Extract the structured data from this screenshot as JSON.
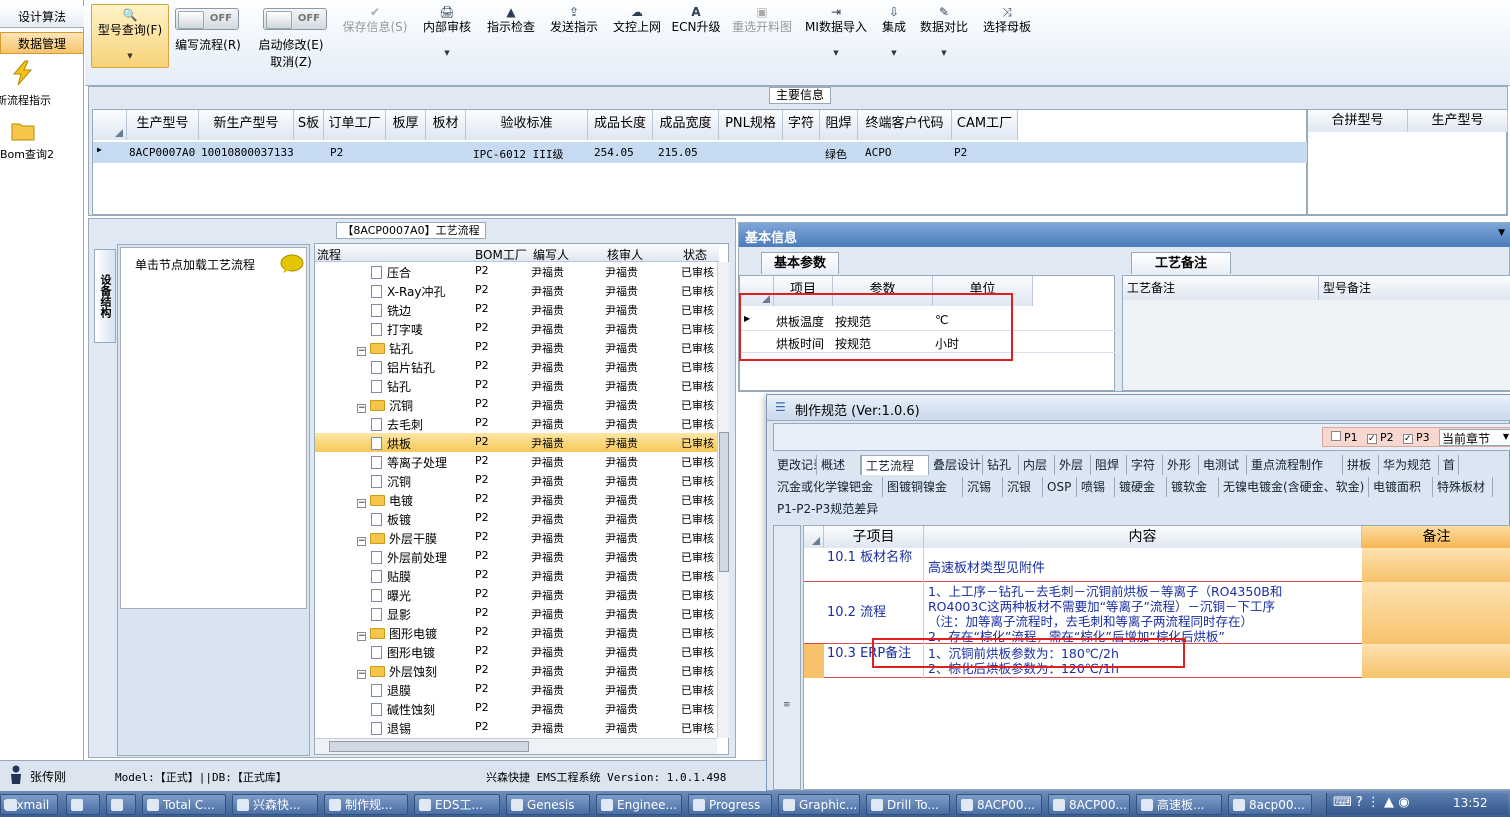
{
  "leftnav": {
    "tab1": "设计算法",
    "tab2": "数据管理",
    "item1": "新流程指示",
    "item2": "Bom查询2",
    "user": "张传刚"
  },
  "ribbon": {
    "buttons": [
      {
        "label": "型号查询(F)",
        "icon": "🔍"
      },
      {
        "label": "保存信息(S)",
        "icon": "✔"
      },
      {
        "label": "内部审核",
        "icon": "🖨"
      },
      {
        "label": "指示检查",
        "icon": "▲"
      },
      {
        "label": "发送指示",
        "icon": "⇪"
      },
      {
        "label": "文控上网",
        "icon": "☁"
      },
      {
        "label": "ECN升级",
        "icon": "A"
      },
      {
        "label": "重选开料图",
        "icon": "▣"
      },
      {
        "label": "MI数据导入",
        "icon": "⇥"
      },
      {
        "label": "集成",
        "icon": "⇩"
      },
      {
        "label": "数据对比",
        "icon": "✎"
      },
      {
        "label": "选择母板",
        "icon": "⤨"
      }
    ],
    "toggle1": {
      "state": "OFF",
      "label": "编写流程(R)"
    },
    "toggle2": {
      "state": "OFF",
      "label": "启动修改(E)",
      "sub": "取消(Z)"
    }
  },
  "main_info": {
    "title": "主要信息",
    "columns": [
      "生产型号",
      "新生产型号",
      "S板",
      "订单工厂",
      "板厚",
      "板材",
      "验收标准",
      "成品长度",
      "成品宽度",
      "PNL规格",
      "字符",
      "阻焊",
      "终端客户代码",
      "CAM工厂"
    ],
    "row": [
      "8ACP0007A0",
      "10010800037133",
      "",
      "P2",
      "",
      "",
      "IPC-6012 III级",
      "254.05",
      "215.05",
      "",
      "",
      "绿色",
      "ACPO",
      "P2"
    ],
    "side_columns": [
      "合拼型号",
      "生产型号"
    ]
  },
  "process": {
    "title": "【8ACP0007A0】工艺流程",
    "side_tab": "设备结构",
    "load_hint": "单击节点加载工艺流程",
    "columns": [
      "流程",
      "BOM工厂",
      "编写人",
      "核审人",
      "状态"
    ],
    "rows": [
      {
        "name": "压合",
        "type": "doc",
        "f": "P2",
        "w": "尹福贵",
        "r": "尹福贵",
        "s": "已审核"
      },
      {
        "name": "X-Ray冲孔",
        "type": "doc",
        "f": "P2",
        "w": "尹福贵",
        "r": "尹福贵",
        "s": "已审核"
      },
      {
        "name": "铣边",
        "type": "doc",
        "f": "P2",
        "w": "尹福贵",
        "r": "尹福贵",
        "s": "已审核"
      },
      {
        "name": "打字唛",
        "type": "doc",
        "f": "P2",
        "w": "尹福贵",
        "r": "尹福贵",
        "s": "已审核"
      },
      {
        "name": "钻孔",
        "type": "folder",
        "f": "P2",
        "w": "尹福贵",
        "r": "尹福贵",
        "s": "已审核"
      },
      {
        "name": "铝片钻孔",
        "type": "doc",
        "f": "P2",
        "w": "尹福贵",
        "r": "尹福贵",
        "s": "已审核"
      },
      {
        "name": "钻孔",
        "type": "doc",
        "f": "P2",
        "w": "尹福贵",
        "r": "尹福贵",
        "s": "已审核"
      },
      {
        "name": "沉铜",
        "type": "folder",
        "f": "P2",
        "w": "尹福贵",
        "r": "尹福贵",
        "s": "已审核"
      },
      {
        "name": "去毛刺",
        "type": "doc",
        "f": "P2",
        "w": "尹福贵",
        "r": "尹福贵",
        "s": "已审核"
      },
      {
        "name": "烘板",
        "type": "doc",
        "f": "P2",
        "w": "尹福贵",
        "r": "尹福贵",
        "s": "已审核",
        "sel": true
      },
      {
        "name": "等离子处理",
        "type": "doc",
        "f": "P2",
        "w": "尹福贵",
        "r": "尹福贵",
        "s": "已审核"
      },
      {
        "name": "沉铜",
        "type": "doc",
        "f": "P2",
        "w": "尹福贵",
        "r": "尹福贵",
        "s": "已审核"
      },
      {
        "name": "电镀",
        "type": "folder",
        "f": "P2",
        "w": "尹福贵",
        "r": "尹福贵",
        "s": "已审核"
      },
      {
        "name": "板镀",
        "type": "doc",
        "f": "P2",
        "w": "尹福贵",
        "r": "尹福贵",
        "s": "已审核"
      },
      {
        "name": "外层干膜",
        "type": "folder",
        "f": "P2",
        "w": "尹福贵",
        "r": "尹福贵",
        "s": "已审核"
      },
      {
        "name": "外层前处理",
        "type": "doc",
        "f": "P2",
        "w": "尹福贵",
        "r": "尹福贵",
        "s": "已审核"
      },
      {
        "name": "贴膜",
        "type": "doc",
        "f": "P2",
        "w": "尹福贵",
        "r": "尹福贵",
        "s": "已审核"
      },
      {
        "name": "曝光",
        "type": "doc",
        "f": "P2",
        "w": "尹福贵",
        "r": "尹福贵",
        "s": "已审核"
      },
      {
        "name": "显影",
        "type": "doc",
        "f": "P2",
        "w": "尹福贵",
        "r": "尹福贵",
        "s": "已审核"
      },
      {
        "name": "图形电镀",
        "type": "folder",
        "f": "P2",
        "w": "尹福贵",
        "r": "尹福贵",
        "s": "已审核"
      },
      {
        "name": "图形电镀",
        "type": "doc",
        "f": "P2",
        "w": "尹福贵",
        "r": "尹福贵",
        "s": "已审核"
      },
      {
        "name": "外层蚀刻",
        "type": "folder",
        "f": "P2",
        "w": "尹福贵",
        "r": "尹福贵",
        "s": "已审核"
      },
      {
        "name": "退膜",
        "type": "doc",
        "f": "P2",
        "w": "尹福贵",
        "r": "尹福贵",
        "s": "已审核"
      },
      {
        "name": "碱性蚀刻",
        "type": "doc",
        "f": "P2",
        "w": "尹福贵",
        "r": "尹福贵",
        "s": "已审核"
      },
      {
        "name": "退锡",
        "type": "doc",
        "f": "P2",
        "w": "尹福贵",
        "r": "尹福贵",
        "s": "已审核"
      }
    ]
  },
  "basic": {
    "title": "基本信息",
    "tab": "基本参数",
    "columns": [
      "项目",
      "参数",
      "单位"
    ],
    "rows": [
      [
        "烘板温度",
        "按规范",
        "℃"
      ],
      [
        "烘板时间",
        "按规范",
        "小时"
      ]
    ],
    "remark_tab": "工艺备注",
    "remark_cols": [
      "工艺备注",
      "型号备注"
    ]
  },
  "spec": {
    "title": "制作规范 (Ver:1.0.6)",
    "checks": [
      "P1",
      "P2",
      "P3"
    ],
    "chapter": "当前章节",
    "tabs1": [
      "更改记录",
      "概述",
      "工艺流程",
      "叠层设计",
      "钻孔",
      "内层",
      "外层",
      "阻焊",
      "字符",
      "外形",
      "电测试",
      "重点流程制作",
      "拼板",
      "华为规范",
      "首"
    ],
    "tabs2": [
      "沉金或化学镍钯金",
      "图镀铜镍金",
      "沉锡",
      "沉银",
      "OSP",
      "喷锡",
      "镀硬金",
      "镀软金",
      "无镍电镀金(含硬金、软金)",
      "电镀面积",
      "特殊板材"
    ],
    "tab3": "P1-P2-P3规范差异",
    "columns": [
      "子项目",
      "内容",
      "备注"
    ],
    "rows": [
      {
        "sub": "10.1 板材名称",
        "lines": [
          "高速板材类型见附件"
        ]
      },
      {
        "sub": "10.2 流程",
        "lines": [
          "1、上工序－钻孔－去毛刺－沉铜前烘板－等离子（RO4350B和",
          "RO4003C这两种板材不需要加“等离子”流程）－沉铜－下工序",
          "（注：加等离子流程时，去毛刺和等离子两流程同时存在）",
          "2、存在“棕化”流程，需在“棕化”后增加“棕化后烘板”"
        ]
      },
      {
        "sub": "10.3 ERP备注",
        "lines": [
          "1、沉铜前烘板参数为：180℃/2h",
          "2、棕化后烘板参数为：120℃/1h"
        ]
      }
    ]
  },
  "status": {
    "model": "Model:【正式】||DB:【正式库】",
    "app": "兴森快捷  EMS工程系统  Version: 1.0.1.498"
  },
  "taskbar": {
    "items": [
      "Foxmail",
      "",
      "",
      "Total C...",
      "兴森快...",
      "制作规...",
      "EDS工...",
      "Genesis",
      "Enginee...",
      "Progress",
      "Graphic...",
      "Drill To...",
      "8ACP00...",
      "8ACP00...",
      "高速板...",
      "8acp00..."
    ],
    "time": "13:52"
  }
}
